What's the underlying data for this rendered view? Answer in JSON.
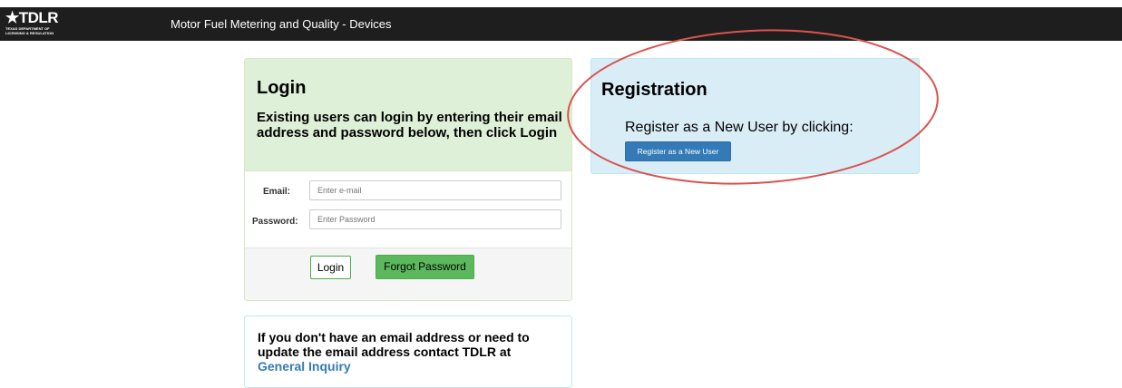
{
  "header": {
    "logo_text": "TDLR",
    "logo_subtext_line1": "TEXAS DEPARTMENT OF",
    "logo_subtext_line2": "LICENSING & REGULATION",
    "app_title": "Motor Fuel Metering and Quality - Devices"
  },
  "login": {
    "title": "Login",
    "description": "Existing users can login by entering their email address and password below, then click Login",
    "email_label": "Email:",
    "email_placeholder": "Enter e-mail",
    "password_label": "Password:",
    "password_placeholder": "Enter Password",
    "login_button": "Login",
    "forgot_button": "Forgot Password"
  },
  "info": {
    "text": "If you don't have an email address or need to update the email address contact TDLR at",
    "link": "General Inquiry"
  },
  "registration": {
    "title": "Registration",
    "description": "Register as a New User by clicking:",
    "button": "Register as a New User"
  },
  "colors": {
    "topbar": "#1e1e1e",
    "login_header": "#dff0d8",
    "registration_bg": "#d9edf7",
    "primary_button": "#337ab7",
    "success_button": "#5cb85c",
    "annotation": "#d9534f"
  }
}
